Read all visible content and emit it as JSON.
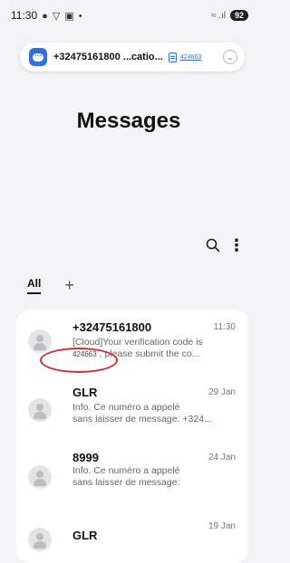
{
  "status_bar": {
    "time": "11:30",
    "left_icons": "● ▽ ▣ •",
    "signal": "≈ .ıl",
    "battery": "92"
  },
  "notification": {
    "sender": "+32475161800 ...catio...",
    "code": "424663"
  },
  "page_title": "Messages",
  "tabs": {
    "all": "All",
    "add": "+"
  },
  "conversations": [
    {
      "name": "+32475161800",
      "time": "11:30",
      "line1": "[Cloud]Your verification code is",
      "code": "424663",
      "line2_rest": ", please submit the co..."
    },
    {
      "name": "GLR",
      "time": "29 Jan",
      "line1": "Info. Ce numéro a appelé",
      "line2": "sans laisser de message: +324..."
    },
    {
      "name": "8999",
      "time": "24 Jan",
      "line1": "Info. Ce numéro a appelé",
      "line2": "sans laisser de message: "
    },
    {
      "name": "GLR",
      "time": "19 Jan"
    }
  ],
  "colors": {
    "accent": "#2f6fe6",
    "annotation": "#d12b2b",
    "background": "#f3f3f5"
  },
  "icons": {
    "search": "search-icon",
    "more": "more-vert-icon",
    "app": "messages-app-icon"
  }
}
